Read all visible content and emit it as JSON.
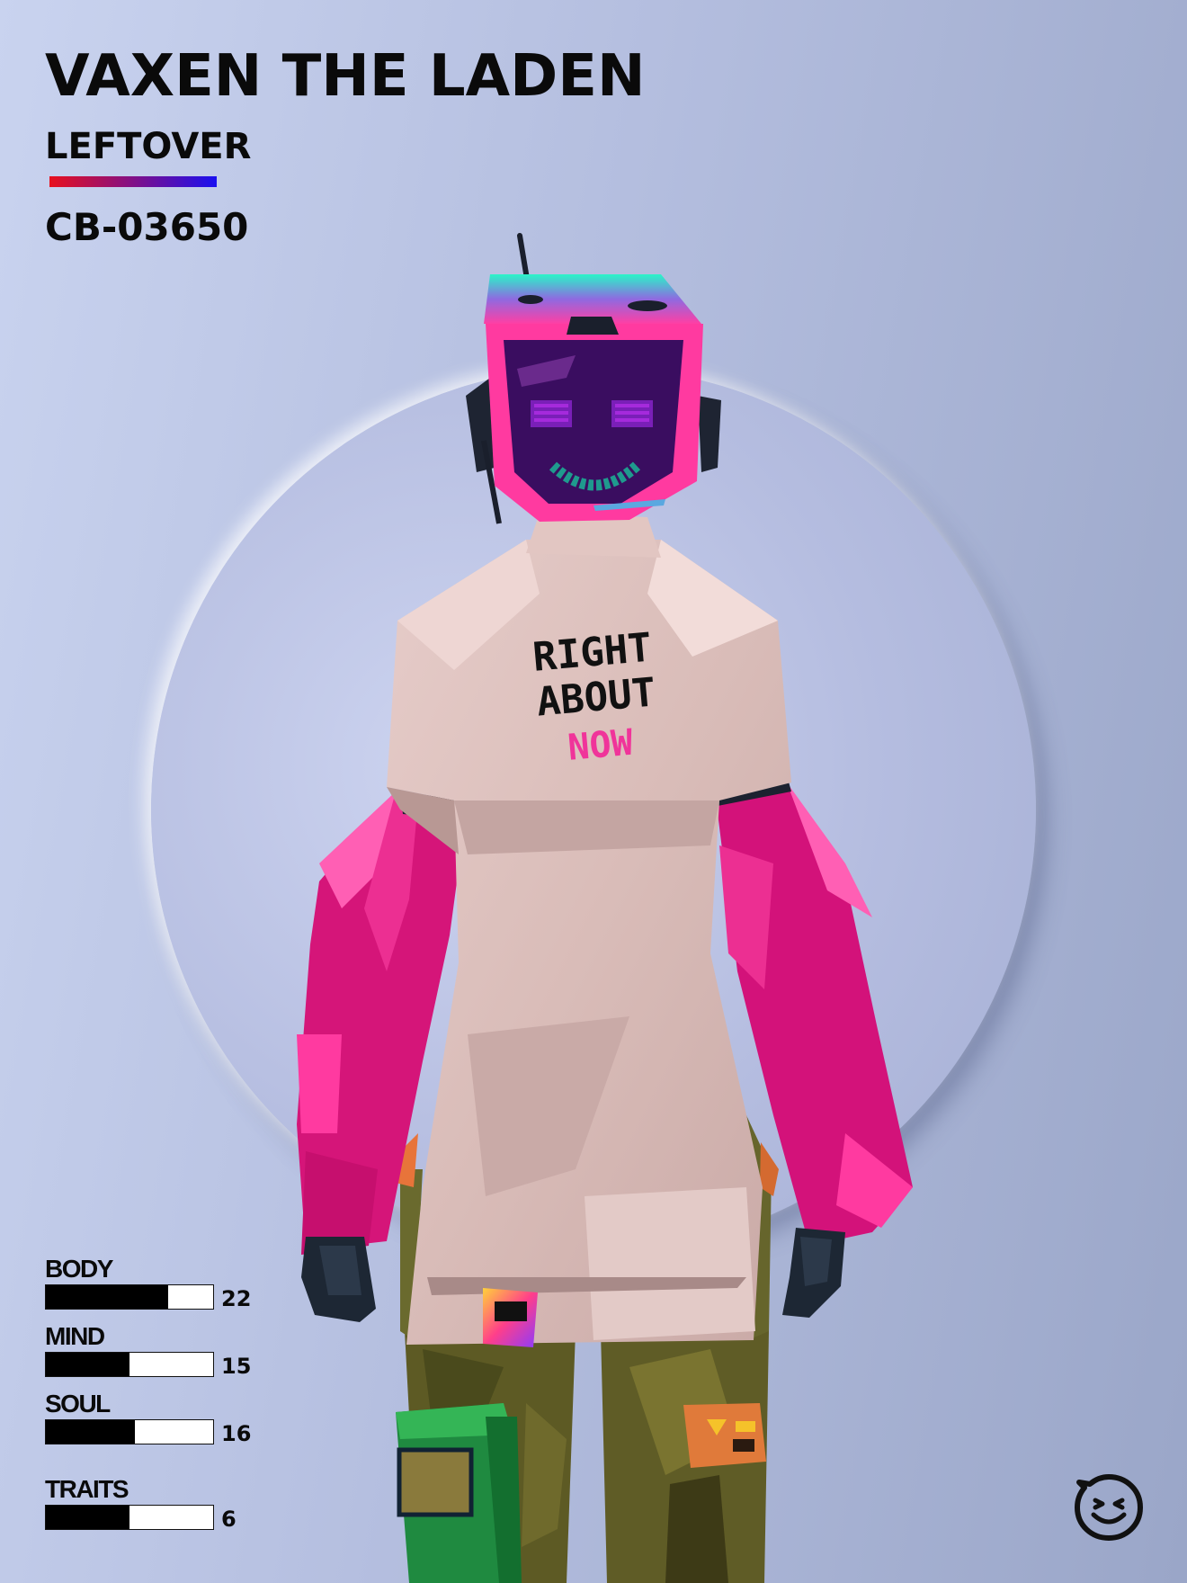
{
  "card": {
    "name": "VAXEN THE LADEN",
    "class": "LEFTOVER",
    "serial": "CB-03650"
  },
  "shirt": {
    "line1": "RIGHT",
    "line2": "ABOUT",
    "line3": "NOW"
  },
  "stats": [
    {
      "label": "BODY",
      "value": "22",
      "fill": 0.73
    },
    {
      "label": "MIND",
      "value": "15",
      "fill": 0.5
    },
    {
      "label": "SOUL",
      "value": "16",
      "fill": 0.53
    },
    {
      "label": "TRAITS",
      "value": "6",
      "fill": 0.5
    }
  ],
  "colors": {
    "rarity_gradient_start": "#e8101e",
    "rarity_gradient_end": "#1a10f0",
    "accent_pink": "#f0349a",
    "sleeve_magenta": "#e0147f",
    "visor_purple": "#4a0a6e"
  },
  "icons": {
    "brand_logo": "smiley-face-icon"
  }
}
